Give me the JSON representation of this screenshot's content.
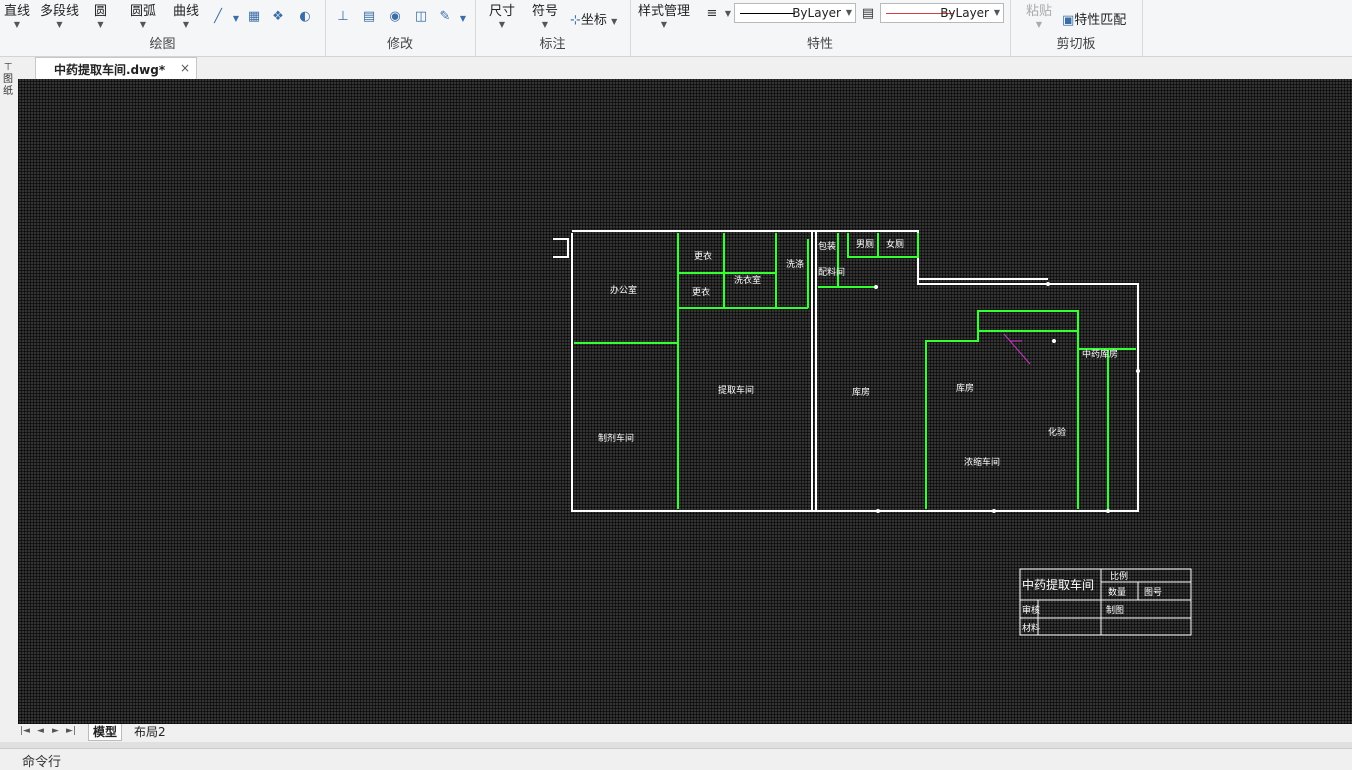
{
  "ribbon": {
    "draw_group": {
      "label": "绘图",
      "line": "直线",
      "polyline": "多段线",
      "circle": "圆",
      "arc": "圆弧",
      "curve": "曲线"
    },
    "modify_group": {
      "label": "修改"
    },
    "annotate_group": {
      "label": "标注",
      "dimension": "尺寸",
      "symbol": "符号",
      "coordinate": "坐标"
    },
    "properties_group": {
      "label": "特性",
      "style_manager": "样式管理",
      "linetype_value": "ByLayer",
      "lineweight_value": "ByLayer",
      "linetype_swatch_color": "#000000",
      "lineweight_swatch_color": "#d04040"
    },
    "clipboard_group": {
      "label": "剪切板",
      "paste": "粘贴",
      "match_props": "特性匹配"
    }
  },
  "document_tab": {
    "title": "中药提取车间.dwg*",
    "close": "×"
  },
  "side_strip": {
    "text": "图纸"
  },
  "drawing": {
    "background": "#333333",
    "wall_color": "#ffffff",
    "partition_color": "#33ff33",
    "rooms": [
      "办公室",
      "更衣",
      "更衣",
      "洗衣室",
      "洗涤",
      "提取车间",
      "制剂车间",
      "库房",
      "包装",
      "配料间",
      "男厕",
      "女厕",
      "中药库房",
      "浓缩车间",
      "化验",
      "库房"
    ],
    "title_block": {
      "title": "中药提取车间",
      "cells": [
        "比例",
        "数量",
        "图号",
        "制图",
        "审核",
        "材料"
      ]
    }
  },
  "layout_tabs": {
    "model": "模型",
    "layout2": "布局2"
  },
  "command_line": {
    "label": "命令行"
  }
}
